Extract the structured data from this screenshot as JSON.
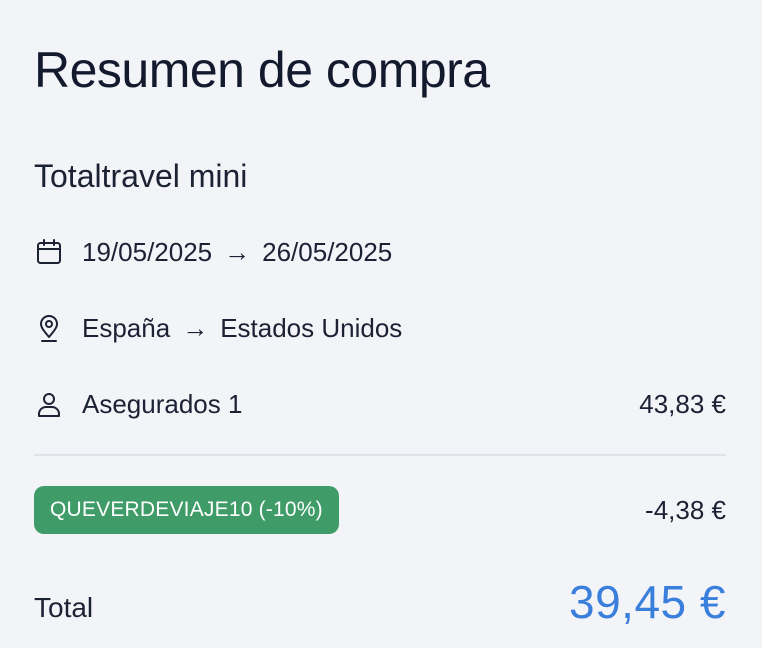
{
  "summary": {
    "title": "Resumen de compra",
    "product_name": "Totaltravel mini",
    "dates": {
      "icon": "calendar-icon",
      "start": "19/05/2025",
      "arrow": "→",
      "end": "26/05/2025"
    },
    "route": {
      "icon": "location-pin-icon",
      "origin": "España",
      "arrow": "→",
      "destination": "Estados Unidos"
    },
    "insured": {
      "icon": "user-icon",
      "label": "Asegurados 1",
      "amount": "43,83 €"
    },
    "discount": {
      "code": "QUEVERDEVIAJE10 (-10%)",
      "amount": "-4,38 €",
      "badge_color": "#3f9c68"
    },
    "total": {
      "label": "Total",
      "amount": "39,45 €",
      "color": "#3b7fdc"
    }
  }
}
